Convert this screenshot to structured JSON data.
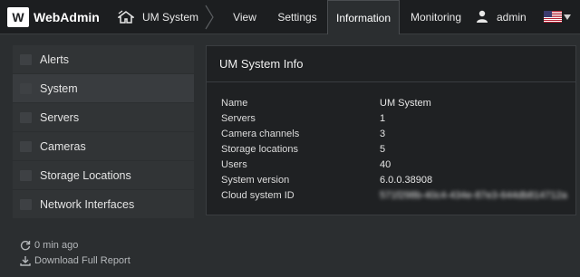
{
  "header": {
    "logo_letter": "W",
    "app_name": "WebAdmin",
    "system_name": "UM System",
    "nav": [
      "View",
      "Settings",
      "Information",
      "Monitoring"
    ],
    "active_nav": "Information",
    "user": "admin"
  },
  "sidebar": {
    "items": [
      {
        "label": "Alerts",
        "icon": "alert-icon"
      },
      {
        "label": "System",
        "icon": "system-icon"
      },
      {
        "label": "Servers",
        "icon": "servers-icon"
      },
      {
        "label": "Cameras",
        "icon": "cameras-icon"
      },
      {
        "label": "Storage Locations",
        "icon": "storage-icon"
      },
      {
        "label": "Network Interfaces",
        "icon": "network-icon"
      }
    ],
    "active": "System",
    "updated": "0 min ago",
    "download": "Download Full Report"
  },
  "panel": {
    "title": "UM System Info",
    "rows": [
      {
        "key": "Name",
        "value": "UM System"
      },
      {
        "key": "Servers",
        "value": "1"
      },
      {
        "key": "Camera channels",
        "value": "3"
      },
      {
        "key": "Storage locations",
        "value": "5"
      },
      {
        "key": "Users",
        "value": "40"
      },
      {
        "key": "System version",
        "value": "6.0.0.38908"
      },
      {
        "key": "Cloud system ID",
        "value": "571f298b-40c4-434e-87e3-644db814712a"
      }
    ]
  },
  "colors": {
    "header_bg": "#1c1e20",
    "body_bg": "#2b2e30",
    "panel_bg": "#1f2123"
  }
}
